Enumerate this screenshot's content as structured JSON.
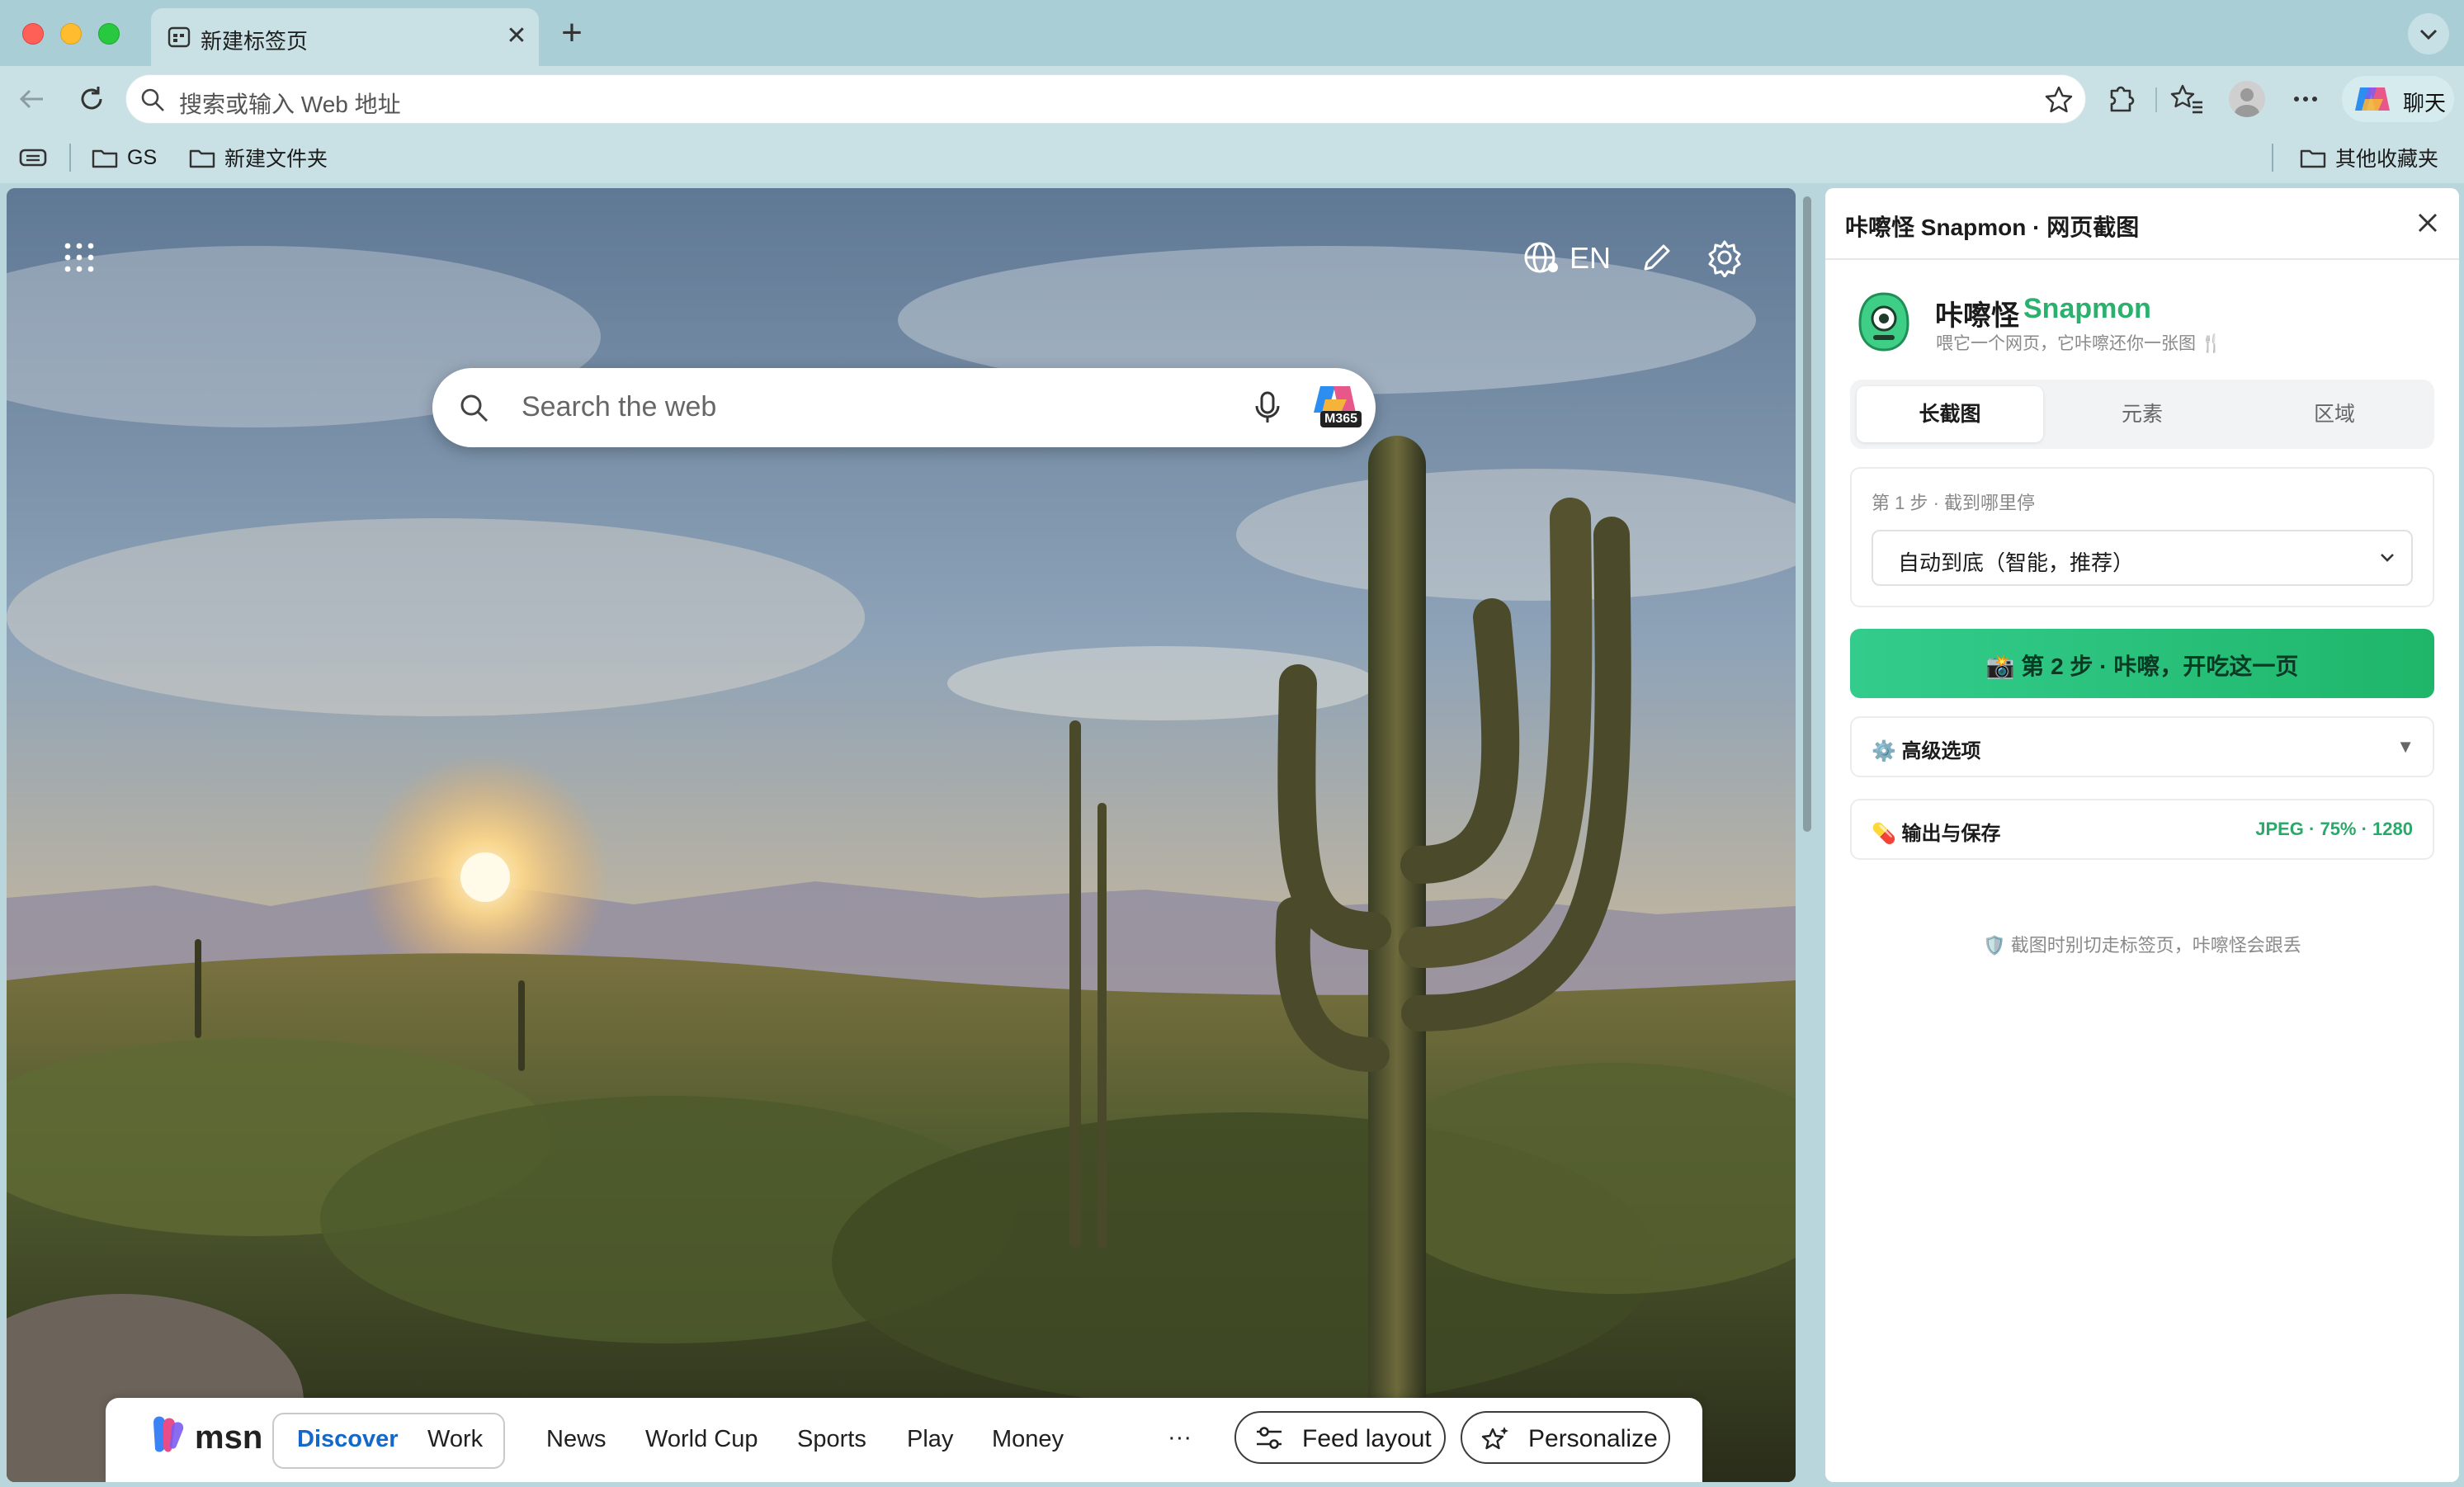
{
  "tab": {
    "title": "新建标签页",
    "close_glyph": "✕",
    "new_tab_glyph": "+"
  },
  "addressbar": {
    "placeholder": "搜索或输入 Web 地址"
  },
  "toolbar": {
    "copilot_label": "聊天"
  },
  "bookmarks": {
    "items": [
      "GS",
      "新建文件夹"
    ],
    "other": "其他收藏夹"
  },
  "ntp": {
    "language": "EN",
    "search_placeholder": "Search the web",
    "copilot_badge": "M365"
  },
  "msn": {
    "logo": "msn",
    "tabs": [
      "Discover",
      "Work"
    ],
    "nav": [
      "News",
      "World Cup",
      "Sports",
      "Play",
      "Money"
    ],
    "more": "···",
    "feed_layout": "Feed layout",
    "personalize": "Personalize"
  },
  "sidepanel": {
    "title": "咔嚓怪 Snapmon · 网页截图",
    "brand_cn": "咔嚓怪",
    "brand_en": "Snapmon",
    "tagline": "喂它一个网页，它咔嚓还你一张图 🍴",
    "modes": [
      "长截图",
      "元素",
      "区域"
    ],
    "active_mode": "长截图",
    "step1_label": "第 1 步 · 截到哪里停",
    "step1_value": "自动到底（智能，推荐）",
    "step2_button": "📸 第 2 步 · 咔嚓，开吃这一页",
    "advanced": "⚙️ 高级选项",
    "advanced_caret": "▼",
    "output_label": "💊 输出与保存",
    "output_meta": "JPEG · 75% · 1280",
    "footnote": "🛡️ 截图时别切走标签页，咔嚓怪会跟丢"
  },
  "colors": {
    "accent_green": "#2bb06e",
    "msn_active": "#1468c9",
    "chrome_teal": "#a9ced5"
  }
}
